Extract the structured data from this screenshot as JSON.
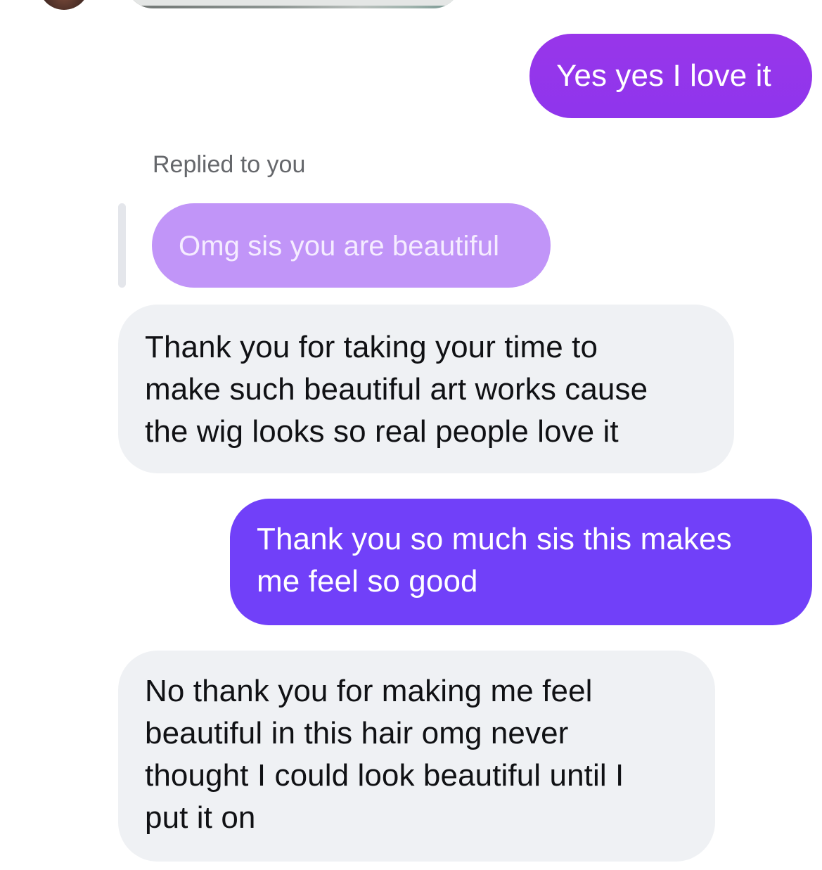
{
  "thread": {
    "top_avatar_icon": "contact-avatar",
    "top_media_icon": "image-attachment",
    "messages": [
      {
        "direction": "sent",
        "text": "Yes yes I love it",
        "color": "#9333ea"
      },
      {
        "direction": "received",
        "reply_context": {
          "label": "Replied to you",
          "quoted_text": "Omg sis you are beautiful",
          "quoted_color": "#c195f8"
        },
        "text": "Thank you for taking your time to\nmake such beautiful art works cause\nthe wig looks so real people love it",
        "color": "#eff1f4"
      },
      {
        "direction": "sent",
        "text": "Thank you so much sis this makes\nme feel so good",
        "color": "#7140f9"
      },
      {
        "direction": "received",
        "text": "No thank you for making me feel\nbeautiful in this hair omg never\nthought I could look beautiful until I\nput it on",
        "color": "#eff1f4"
      }
    ]
  }
}
